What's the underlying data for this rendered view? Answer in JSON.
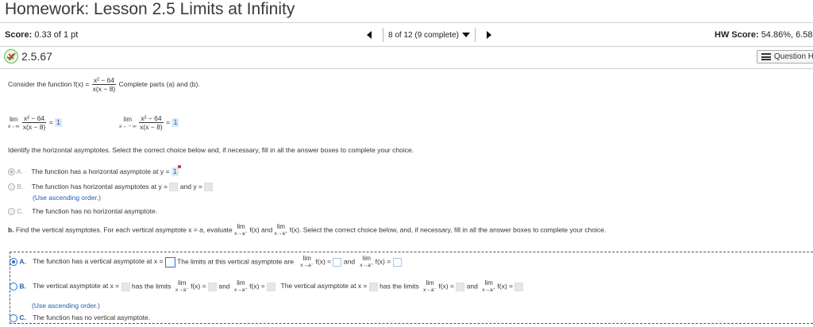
{
  "header": {
    "title": "Homework: Lesson 2.5 Limits at Infinity",
    "score_label": "Score:",
    "score_value": "0.33 of 1 pt",
    "pager_text": "8 of 12 (9 complete)",
    "hw_score_label": "HW Score:",
    "hw_score_value": "54.86%, 6.58"
  },
  "question": {
    "number": "2.5.67",
    "help_label": "Question H"
  },
  "problem": {
    "intro": "Consider the function f(x) =",
    "func_num": "x² − 64",
    "func_den": "x(x − 8)",
    "intro_tail": "Complete parts (a) and (b).",
    "lim1_sub": "x→∞",
    "lim1_answer": "1",
    "lim2_sub": "x→ − ∞",
    "lim2_answer": "1",
    "equals": "="
  },
  "part_a": {
    "instruction": "Identify the horizontal asymptotes. Select the correct choice below and, if necessary, fill in all the answer boxes to complete your choice.",
    "choice_a_letter": "A.",
    "choice_a_text": "The function has a horizontal asymptote at y =",
    "choice_a_answer": "1",
    "choice_b_letter": "B.",
    "choice_b_text": "The function has horizontal asymptotes at y =",
    "choice_b_and": "and y =",
    "choice_b_hint": "(Use ascending order.)",
    "choice_c_letter": "C.",
    "choice_c_text": "The function has no horizontal asymptote."
  },
  "part_b": {
    "prefix": "b.",
    "instruction_1": "Find the vertical asymptotes. For each vertical asymptote x = a, evaluate",
    "instruction_and": "and",
    "instruction_2": "Select the correct choice below, and, if necessary, fill in all the answer boxes to complete your choice.",
    "lim_word": "lim",
    "fx": "f(x).",
    "fx_plain": "f(x)",
    "fx_eq": "f(x) =",
    "sub_minus": "x→a⁻",
    "sub_plus": "x→a⁺",
    "choice_a_letter": "A.",
    "choice_a_text": "The function has a vertical asymptote at x =",
    "choice_a_mid": "The limits at this vertical asymptote are",
    "choice_a_and": "and",
    "choice_b_letter": "B.",
    "choice_b_text": "The vertical asymptote at x =",
    "choice_b_has": "has the limits",
    "choice_b_and": "and",
    "choice_b_text2": "The vertical asymptote at x =",
    "choice_b_has2": "has the limits",
    "choice_b_and2": "and",
    "choice_b_hint": "(Use ascending order.)",
    "choice_c_letter": "C.",
    "choice_c_text": "The function has no vertical asymptote."
  },
  "colors": {
    "accent_blue": "#2b6fcf",
    "answer_text": "#1e5fae",
    "correct_green": "#6bb05a",
    "incorrect_red": "#d23c3c"
  },
  "icons": {
    "question_status": "partially-correct-icon",
    "prev": "triangle-left-icon",
    "next": "triangle-right-icon",
    "dropdown": "chevron-down-icon",
    "help": "list-icon"
  }
}
